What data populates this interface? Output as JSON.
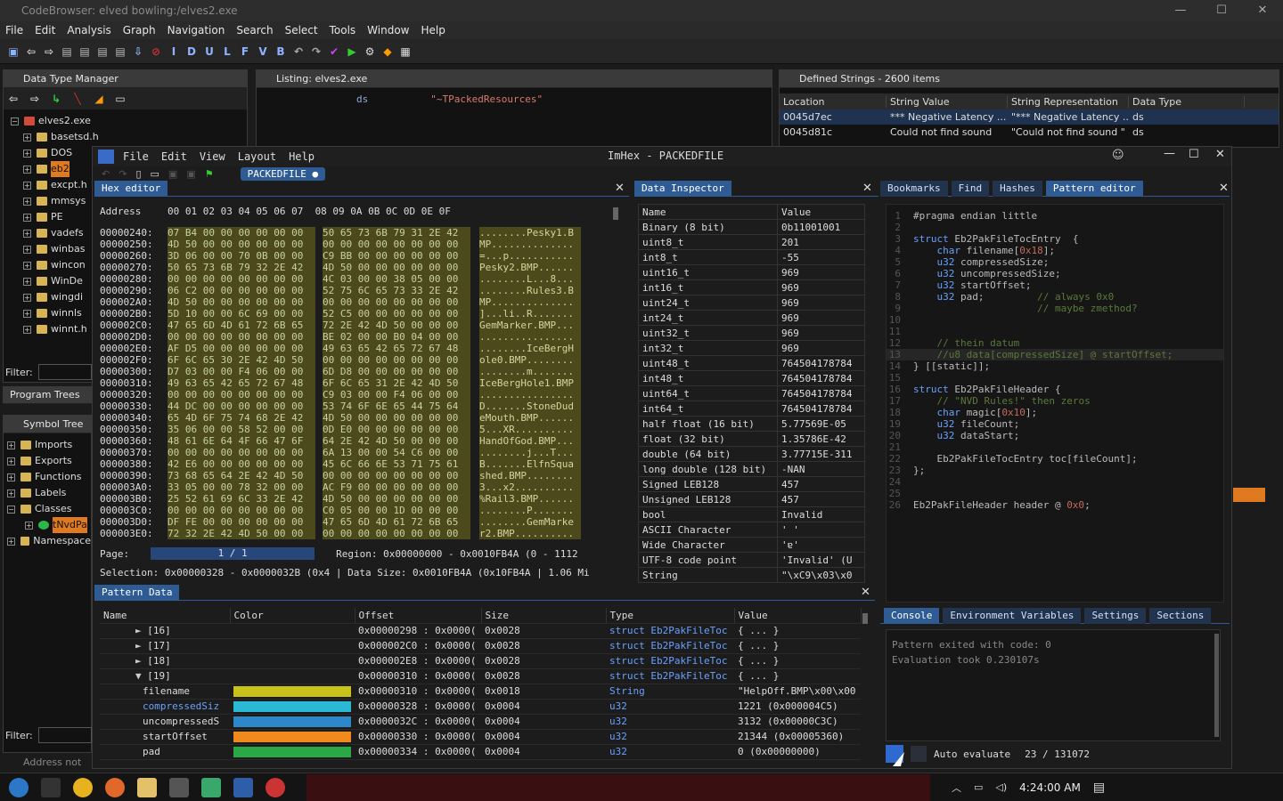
{
  "ghidra": {
    "title": "CodeBrowser: elved bowling:/elves2.exe",
    "menu": [
      "File",
      "Edit",
      "Analysis",
      "Graph",
      "Navigation",
      "Search",
      "Select",
      "Tools",
      "Window",
      "Help"
    ],
    "dtm": {
      "title": "Data Type Manager",
      "tree_root": "elves2.exe",
      "items": [
        "basetsd.h",
        "DOS",
        "eb2",
        "excpt.h",
        "mmsys",
        "PE",
        "vadefs",
        "winbas",
        "wincon",
        "WinDe",
        "wingdi",
        "winnls",
        "winnt.h"
      ],
      "filter_label": "Filter:"
    },
    "program_trees_label": "Program Trees",
    "symbol_tree": {
      "title": "Symbol Tree",
      "items": [
        "Imports",
        "Exports",
        "Functions",
        "Labels",
        "Classes",
        "Namespace"
      ],
      "class_child": "tNvdPa",
      "filter_label": "Filter:"
    },
    "listing": {
      "title": "Listing:  elves2.exe",
      "mnemonic": "ds",
      "operand": "\"~TPackedResources\""
    },
    "defined_strings": {
      "title": "Defined Strings - 2600 items",
      "columns": [
        "Location",
        "String Value",
        "String Representation",
        "Data Type"
      ],
      "rows": [
        [
          "0045d7ec",
          "*** Negative Latency ...",
          "\"*** Negative Latency ...",
          "ds"
        ],
        [
          "0045d81c",
          "Could not find sound",
          "\"Could not find sound \"",
          "ds"
        ]
      ]
    },
    "status_text": "Address not fou"
  },
  "imhex": {
    "menu": [
      "File",
      "Edit",
      "View",
      "Layout",
      "Help"
    ],
    "title": "ImHex - PACKEDFILE",
    "file_tab": "PACKEDFILE",
    "hex_editor": {
      "title": "Hex editor",
      "address_label": "Address",
      "columns": "00 01 02 03 04 05 06 07  08 09 0A 0B 0C 0D 0E 0F",
      "rows": [
        [
          "00000240:",
          "07 B4 00 00 00 00 00 00",
          "50 65 73 6B 79 31 2E 42",
          "........Pesky1.B"
        ],
        [
          "00000250:",
          "4D 50 00 00 00 00 00 00",
          "00 00 00 00 00 00 00 00",
          "MP.............."
        ],
        [
          "00000260:",
          "3D 06 00 00 70 0B 00 00",
          "C9 BB 00 00 00 00 00 00",
          "=...p..........."
        ],
        [
          "00000270:",
          "50 65 73 6B 79 32 2E 42",
          "4D 50 00 00 00 00 00 00",
          "Pesky2.BMP......"
        ],
        [
          "00000280:",
          "00 00 00 00 00 00 00 00",
          "4C 03 00 00 38 05 00 00",
          "........L...8..."
        ],
        [
          "00000290:",
          "06 C2 00 00 00 00 00 00",
          "52 75 6C 65 73 33 2E 42",
          "........Rules3.B"
        ],
        [
          "000002A0:",
          "4D 50 00 00 00 00 00 00",
          "00 00 00 00 00 00 00 00",
          "MP.............."
        ],
        [
          "000002B0:",
          "5D 10 00 00 6C 69 00 00",
          "52 C5 00 00 00 00 00 00",
          "]...li..R......."
        ],
        [
          "000002C0:",
          "47 65 6D 4D 61 72 6B 65",
          "72 2E 42 4D 50 00 00 00",
          "GemMarker.BMP..."
        ],
        [
          "000002D0:",
          "00 00 00 00 00 00 00 00",
          "BE 02 00 00 B0 04 00 00",
          "................"
        ],
        [
          "000002E0:",
          "AF D5 00 00 00 00 00 00",
          "49 63 65 42 65 72 67 48",
          "........IceBergH"
        ],
        [
          "000002F0:",
          "6F 6C 65 30 2E 42 4D 50",
          "00 00 00 00 00 00 00 00",
          "ole0.BMP........"
        ],
        [
          "00000300:",
          "D7 03 00 00 F4 06 00 00",
          "6D D8 00 00 00 00 00 00",
          "........m......."
        ],
        [
          "00000310:",
          "49 63 65 42 65 72 67 48",
          "6F 6C 65 31 2E 42 4D 50",
          "IceBergHole1.BMP"
        ],
        [
          "00000320:",
          "00 00 00 00 00 00 00 00",
          "C9 03 00 00 F4 06 00 00",
          "................"
        ],
        [
          "00000330:",
          "44 DC 00 00 00 00 00 00",
          "53 74 6F 6E 65 44 75 64",
          "D.......StoneDud"
        ],
        [
          "00000340:",
          "65 4D 6F 75 74 68 2E 42",
          "4D 50 00 00 00 00 00 00",
          "eMouth.BMP......"
        ],
        [
          "00000350:",
          "35 06 00 00 58 52 00 00",
          "0D E0 00 00 00 00 00 00",
          "5...XR.........."
        ],
        [
          "00000360:",
          "48 61 6E 64 4F 66 47 6F",
          "64 2E 42 4D 50 00 00 00",
          "HandOfGod.BMP..."
        ],
        [
          "00000370:",
          "00 00 00 00 00 00 00 00",
          "6A 13 00 00 54 C6 00 00",
          "........j...T..."
        ],
        [
          "00000380:",
          "42 E6 00 00 00 00 00 00",
          "45 6C 66 6E 53 71 75 61",
          "B.......ElfnSqua"
        ],
        [
          "00000390:",
          "73 68 65 64 2E 42 4D 50",
          "00 00 00 00 00 00 00 00",
          "shed.BMP........"
        ],
        [
          "000003A0:",
          "33 05 00 00 78 32 00 00",
          "AC F9 00 00 00 00 00 00",
          "3...x2.........."
        ],
        [
          "000003B0:",
          "25 52 61 69 6C 33 2E 42",
          "4D 50 00 00 00 00 00 00",
          "%Rail3.BMP......"
        ],
        [
          "000003C0:",
          "00 00 00 00 00 00 00 00",
          "C0 05 00 00 1D 00 00 00",
          "........P......."
        ],
        [
          "000003D0:",
          "DF FE 00 00 00 00 00 00",
          "47 65 6D 4D 61 72 6B 65",
          "........GemMarke"
        ],
        [
          "000003E0:",
          "72 32 2E 42 4D 50 00 00",
          "00 00 00 00 00 00 00 00",
          "r2.BMP.........."
        ]
      ],
      "page_label": "Page:",
      "page_value": "1 / 1",
      "region": "Region: 0x00000000 - 0x0010FB4A (0 - 1112",
      "selection": "Selection: 0x00000328 - 0x0000032B (0x4 | Data Size: 0x0010FB4A (0x10FB4A | 1.06 Mi"
    },
    "data_inspector": {
      "title": "Data Inspector",
      "columns": [
        "Name",
        "Value"
      ],
      "rows": [
        [
          "Binary (8 bit)",
          "0b11001001"
        ],
        [
          "uint8_t",
          "201"
        ],
        [
          "int8_t",
          "-55"
        ],
        [
          "uint16_t",
          "969"
        ],
        [
          "int16_t",
          "969"
        ],
        [
          "uint24_t",
          "969"
        ],
        [
          "int24_t",
          "969"
        ],
        [
          "uint32_t",
          "969"
        ],
        [
          "int32_t",
          "969"
        ],
        [
          "uint48_t",
          "764504178784"
        ],
        [
          "int48_t",
          "764504178784"
        ],
        [
          "uint64_t",
          "764504178784"
        ],
        [
          "int64_t",
          "764504178784"
        ],
        [
          "half float (16 bit)",
          "5.77569E-05"
        ],
        [
          "float (32 bit)",
          "1.35786E-42"
        ],
        [
          "double (64 bit)",
          "3.77715E-311"
        ],
        [
          "long double (128 bit)",
          "-NAN"
        ],
        [
          "Signed LEB128",
          "457"
        ],
        [
          "Unsigned LEB128",
          "457"
        ],
        [
          "bool",
          "Invalid"
        ],
        [
          "ASCII Character",
          "' '"
        ],
        [
          "Wide Character",
          "'ɐ'"
        ],
        [
          "UTF-8 code point",
          "'Invalid' (U"
        ],
        [
          "String",
          "\"\\xC9\\x03\\x0"
        ]
      ]
    },
    "right_tabs": [
      "Bookmarks",
      "Find",
      "Hashes",
      "Pattern editor"
    ],
    "pattern_editor": {
      "lines": [
        "#pragma endian little",
        "",
        "struct Eb2PakFileTocEntry  {",
        "    char filename[0x18];",
        "    u32 compressedSize;",
        "    u32 uncompressedSize;",
        "    u32 startOffset;",
        "    u32 pad;         // always 0x0",
        "                     // maybe zmethod?",
        "",
        "",
        "    // thein datum",
        "    //u8 data[compressedSize] @ startOffset;",
        "} [[static]];",
        "",
        "struct Eb2PakFileHeader {",
        "    // \"NVD Rules!\" then zeros",
        "    char magic[0x10];",
        "    u32 fileCount;",
        "    u32 dataStart;",
        "",
        "    Eb2PakFileTocEntry toc[fileCount];",
        "};",
        "",
        "",
        "Eb2PakFileHeader header @ 0x0;"
      ]
    },
    "console_tabs": [
      "Console",
      "Environment Variables",
      "Settings",
      "Sections"
    ],
    "console_lines": [
      "Pattern exited with code: 0",
      "Evaluation took 0.230107s"
    ],
    "auto_evaluate_label": "Auto evaluate",
    "cursor_pos": "23 / 131072",
    "pattern_data": {
      "title": "Pattern Data",
      "columns": [
        "Name",
        "Color",
        "Offset",
        "Size",
        "Type",
        "Value"
      ],
      "rows": [
        {
          "name": "[16]",
          "indent": 1,
          "arrow": "►",
          "color": "",
          "offset": "0x00000298 : 0x0000(",
          "size": "0x0028",
          "type": "struct Eb2PakFileToc",
          "value": "{ ... }"
        },
        {
          "name": "[17]",
          "indent": 1,
          "arrow": "►",
          "color": "",
          "offset": "0x000002C0 : 0x0000(",
          "size": "0x0028",
          "type": "struct Eb2PakFileToc",
          "value": "{ ... }"
        },
        {
          "name": "[18]",
          "indent": 1,
          "arrow": "►",
          "color": "",
          "offset": "0x000002E8 : 0x0000(",
          "size": "0x0028",
          "type": "struct Eb2PakFileToc",
          "value": "{ ... }"
        },
        {
          "name": "[19]",
          "indent": 1,
          "arrow": "▼",
          "color": "",
          "offset": "0x00000310 : 0x0000(",
          "size": "0x0028",
          "type": "struct Eb2PakFileToc",
          "value": "{ ... }"
        },
        {
          "name": "filename",
          "indent": 2,
          "arrow": "",
          "color": "#c9c21a",
          "offset": "0x00000310 : 0x0000(",
          "size": "0x0018",
          "type": "String",
          "value": "\"HelpOff.BMP\\x00\\x00"
        },
        {
          "name": "compressedSiz",
          "indent": 2,
          "arrow": "",
          "color": "#2ab8d4",
          "offset": "0x00000328 : 0x0000(",
          "size": "0x0004",
          "type": "u32",
          "value": "1221 (0x000004C5)"
        },
        {
          "name": "uncompressedS",
          "indent": 2,
          "arrow": "",
          "color": "#2c88c8",
          "offset": "0x0000032C : 0x0000(",
          "size": "0x0004",
          "type": "u32",
          "value": "3132 (0x00000C3C)"
        },
        {
          "name": "startOffset",
          "indent": 2,
          "arrow": "",
          "color": "#f08a1c",
          "offset": "0x00000330 : 0x0000(",
          "size": "0x0004",
          "type": "u32",
          "value": "21344 (0x00005360)"
        },
        {
          "name": "pad",
          "indent": 2,
          "arrow": "",
          "color": "#2aa845",
          "offset": "0x00000334 : 0x0000(",
          "size": "0x0004",
          "type": "u32",
          "value": "0 (0x00000000)"
        }
      ]
    }
  },
  "taskbar": {
    "time": "4:24:00 AM"
  }
}
